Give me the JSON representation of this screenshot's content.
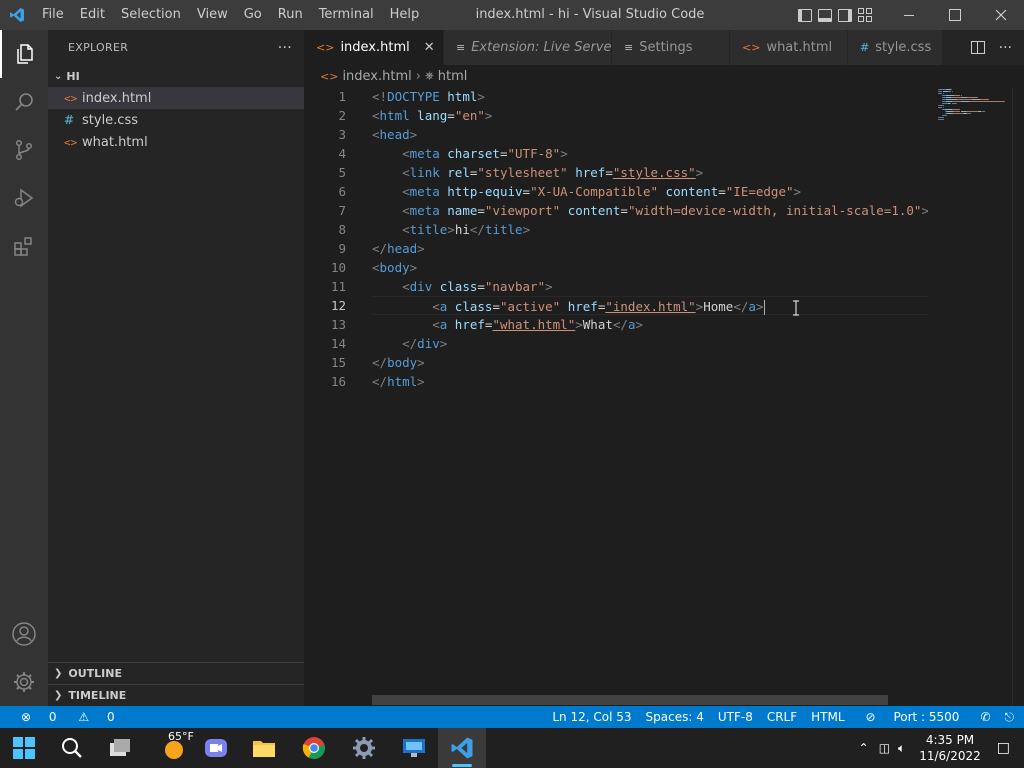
{
  "titlebar": {
    "menu": [
      "File",
      "Edit",
      "Selection",
      "View",
      "Go",
      "Run",
      "Terminal",
      "Help"
    ],
    "title": "index.html - hi - Visual Studio Code"
  },
  "activity": [
    "explorer-icon",
    "search-icon",
    "source-control-icon",
    "run-debug-icon",
    "extensions-icon",
    "account-icon",
    "settings-gear-icon"
  ],
  "sidebar": {
    "header": "EXPLORER",
    "more": "···",
    "folder": "HI",
    "files": [
      {
        "name": "index.html",
        "type": "html"
      },
      {
        "name": "style.css",
        "type": "css"
      },
      {
        "name": "what.html",
        "type": "html"
      }
    ],
    "outline": "OUTLINE",
    "timeline": "TIMELINE"
  },
  "tabs": [
    {
      "label": "index.html",
      "icon": "<>",
      "type": "html"
    },
    {
      "label": "Extension: Live Server",
      "icon": "≡",
      "type": "ext"
    },
    {
      "label": "Settings",
      "icon": "≡",
      "type": "settings"
    },
    {
      "label": "what.html",
      "icon": "<>",
      "type": "html"
    },
    {
      "label": "style.css",
      "icon": "#",
      "type": "css"
    }
  ],
  "breadcrumb": {
    "file": "index.html",
    "node": "html"
  },
  "editor": {
    "current_line": 12,
    "lines": [
      [
        [
          "#808080",
          "<!"
        ],
        [
          "#569cd6",
          "DOCTYPE"
        ],
        [
          "#9cdcfe",
          " html"
        ],
        [
          "#808080",
          ">"
        ]
      ],
      [
        [
          "#808080",
          "<"
        ],
        [
          "#569cd6",
          "html"
        ],
        [
          "#9cdcfe",
          " lang"
        ],
        [
          "#d4d4d4",
          "="
        ],
        [
          "#ce9178",
          "\"en\""
        ],
        [
          "#808080",
          ">"
        ]
      ],
      [
        [
          "#808080",
          "<"
        ],
        [
          "#569cd6",
          "head"
        ],
        [
          "#808080",
          ">"
        ]
      ],
      [
        [
          "#d4d4d4",
          "    "
        ],
        [
          "#808080",
          "<"
        ],
        [
          "#569cd6",
          "meta"
        ],
        [
          "#9cdcfe",
          " charset"
        ],
        [
          "#d4d4d4",
          "="
        ],
        [
          "#ce9178",
          "\"UTF-8\""
        ],
        [
          "#808080",
          ">"
        ]
      ],
      [
        [
          "#d4d4d4",
          "    "
        ],
        [
          "#808080",
          "<"
        ],
        [
          "#569cd6",
          "link"
        ],
        [
          "#9cdcfe",
          " rel"
        ],
        [
          "#d4d4d4",
          "="
        ],
        [
          "#ce9178",
          "\"stylesheet\""
        ],
        [
          "#9cdcfe",
          " href"
        ],
        [
          "#d4d4d4",
          "="
        ],
        [
          "#ce9178",
          "\"style.css\""
        ],
        [
          "#808080",
          ">"
        ]
      ],
      [
        [
          "#d4d4d4",
          "    "
        ],
        [
          "#808080",
          "<"
        ],
        [
          "#569cd6",
          "meta"
        ],
        [
          "#9cdcfe",
          " http-equiv"
        ],
        [
          "#d4d4d4",
          "="
        ],
        [
          "#ce9178",
          "\"X-UA-Compatible\""
        ],
        [
          "#9cdcfe",
          " content"
        ],
        [
          "#d4d4d4",
          "="
        ],
        [
          "#ce9178",
          "\"IE=edge\""
        ],
        [
          "#808080",
          ">"
        ]
      ],
      [
        [
          "#d4d4d4",
          "    "
        ],
        [
          "#808080",
          "<"
        ],
        [
          "#569cd6",
          "meta"
        ],
        [
          "#9cdcfe",
          " name"
        ],
        [
          "#d4d4d4",
          "="
        ],
        [
          "#ce9178",
          "\"viewport\""
        ],
        [
          "#9cdcfe",
          " content"
        ],
        [
          "#d4d4d4",
          "="
        ],
        [
          "#ce9178",
          "\"width=device-width, initial-scale=1.0\""
        ],
        [
          "#808080",
          ">"
        ]
      ],
      [
        [
          "#d4d4d4",
          "    "
        ],
        [
          "#808080",
          "<"
        ],
        [
          "#569cd6",
          "title"
        ],
        [
          "#808080",
          ">"
        ],
        [
          "#d4d4d4",
          "hi"
        ],
        [
          "#808080",
          "</"
        ],
        [
          "#569cd6",
          "title"
        ],
        [
          "#808080",
          ">"
        ]
      ],
      [
        [
          "#808080",
          "</"
        ],
        [
          "#569cd6",
          "head"
        ],
        [
          "#808080",
          ">"
        ]
      ],
      [
        [
          "#808080",
          "<"
        ],
        [
          "#569cd6",
          "body"
        ],
        [
          "#808080",
          ">"
        ]
      ],
      [
        [
          "#d4d4d4",
          "    "
        ],
        [
          "#808080",
          "<"
        ],
        [
          "#569cd6",
          "div"
        ],
        [
          "#9cdcfe",
          " class"
        ],
        [
          "#d4d4d4",
          "="
        ],
        [
          "#ce9178",
          "\"navbar\""
        ],
        [
          "#808080",
          ">"
        ]
      ],
      [
        [
          "#d4d4d4",
          "        "
        ],
        [
          "#808080",
          "<"
        ],
        [
          "#569cd6",
          "a"
        ],
        [
          "#9cdcfe",
          " class"
        ],
        [
          "#d4d4d4",
          "="
        ],
        [
          "#ce9178",
          "\"active\""
        ],
        [
          "#9cdcfe",
          " href"
        ],
        [
          "#d4d4d4",
          "="
        ],
        [
          "#ce9178",
          "\"index.html\""
        ],
        [
          "#808080",
          ">"
        ],
        [
          "#d4d4d4",
          "Home"
        ],
        [
          "#808080",
          "</"
        ],
        [
          "#569cd6",
          "a"
        ],
        [
          "#808080",
          ">"
        ]
      ],
      [
        [
          "#d4d4d4",
          "        "
        ],
        [
          "#808080",
          "<"
        ],
        [
          "#569cd6",
          "a"
        ],
        [
          "#9cdcfe",
          " href"
        ],
        [
          "#d4d4d4",
          "="
        ],
        [
          "#ce9178",
          "\"what.html\""
        ],
        [
          "#808080",
          ">"
        ],
        [
          "#d4d4d4",
          "What"
        ],
        [
          "#808080",
          "</"
        ],
        [
          "#569cd6",
          "a"
        ],
        [
          "#808080",
          ">"
        ]
      ],
      [
        [
          "#d4d4d4",
          "    "
        ],
        [
          "#808080",
          "</"
        ],
        [
          "#569cd6",
          "div"
        ],
        [
          "#808080",
          ">"
        ]
      ],
      [
        [
          "#808080",
          "</"
        ],
        [
          "#569cd6",
          "body"
        ],
        [
          "#808080",
          ">"
        ]
      ],
      [
        [
          "#808080",
          "</"
        ],
        [
          "#569cd6",
          "html"
        ],
        [
          "#808080",
          ">"
        ]
      ]
    ]
  },
  "statusbar": {
    "errors": "0",
    "warnings": "0",
    "position": "Ln 12, Col 53",
    "spaces": "Spaces: 4",
    "encoding": "UTF-8",
    "eol": "CRLF",
    "language": "HTML",
    "port": "Port : 5500"
  },
  "taskbar": {
    "weather": "65°F",
    "time": "4:35 PM",
    "date": "11/6/2022"
  },
  "colors": {
    "accent": "#007acc",
    "html_icon": "#e37933",
    "css_icon": "#519aba"
  }
}
